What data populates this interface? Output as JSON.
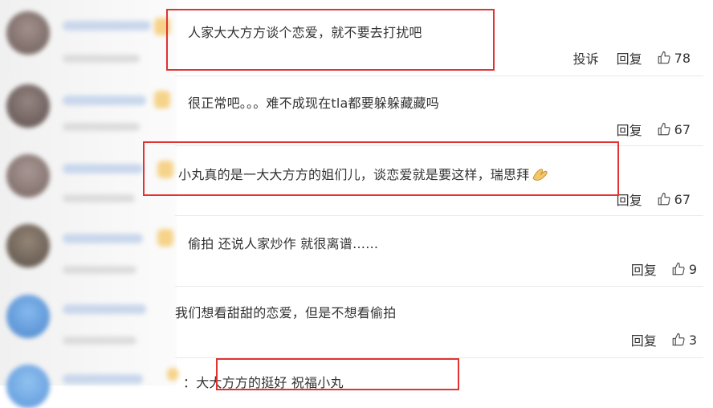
{
  "comments": [
    {
      "text": "人家大大方方谈个恋爱，就不要去打扰吧",
      "actions": [
        "投诉",
        "回复"
      ],
      "likes": "78",
      "avatar_color": "#7a6a66"
    },
    {
      "text": "很正常吧。。。难不成现在tla都要躲躲藏藏吗",
      "actions": [
        "回复"
      ],
      "likes": "67",
      "avatar_color": "#6d5c58"
    },
    {
      "text": "小丸真的是一大大方方的姐们儿，谈恋爱就是要这样，瑞思拜",
      "actions": [
        "回复"
      ],
      "likes": "67",
      "avatar_color": "#8a7470"
    },
    {
      "text": "偷拍 还说人家炒作 就很离谱……",
      "actions": [
        "回复"
      ],
      "likes": "9",
      "avatar_color": "#6a5a4e"
    },
    {
      "text": "我们想看甜甜的恋爱，但是不想看偷拍",
      "actions": [
        "回复"
      ],
      "likes": "3",
      "avatar_color": "#4a8fd6"
    },
    {
      "text": "：大大方方的挺好 祝福小丸",
      "actions": [],
      "likes": "",
      "avatar_color": "#5b9be0"
    }
  ],
  "icons": {
    "like": "thumbs-up-icon",
    "clap": "clapping-hands-emoji"
  },
  "colors": {
    "highlight": "#e23232"
  }
}
